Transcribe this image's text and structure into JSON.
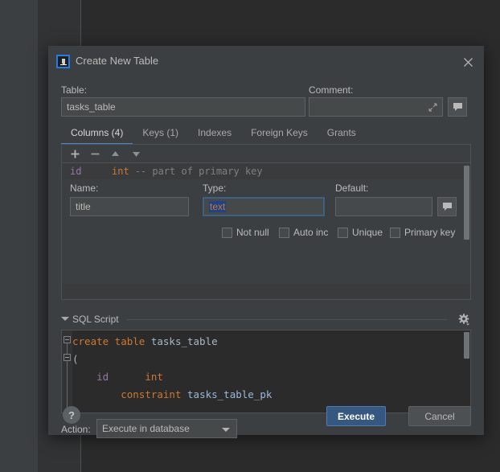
{
  "window": {
    "title": "Create New Table",
    "logo_text": "IJ",
    "close_icon": "close-icon"
  },
  "form": {
    "table_label": "Table:",
    "table_value": "tasks_table",
    "comment_label": "Comment:",
    "comment_value": "",
    "comment_placeholder": "",
    "expand_icon": "expand-icon",
    "comment_button_icon": "comment-bubble-icon"
  },
  "tabs": [
    {
      "label": "Columns (4)",
      "active": true
    },
    {
      "label": "Keys (1)",
      "active": false
    },
    {
      "label": "Indexes",
      "active": false
    },
    {
      "label": "Foreign Keys",
      "active": false
    },
    {
      "label": "Grants",
      "active": false
    }
  ],
  "columns_toolbar": [
    {
      "name": "add-column-button",
      "icon": "plus-icon",
      "label": "+"
    },
    {
      "name": "remove-column-button",
      "icon": "minus-icon",
      "label": "−"
    },
    {
      "name": "move-up-button",
      "icon": "arrow-up-icon",
      "label": "▲"
    },
    {
      "name": "move-down-button",
      "icon": "arrow-down-icon",
      "label": "▼"
    }
  ],
  "columns_rows": [
    {
      "name": "id",
      "type": "int",
      "comment": "-- part of primary key"
    }
  ],
  "column_editor": {
    "name_label": "Name:",
    "name_value": "title",
    "type_label": "Type:",
    "type_value": "text",
    "type_focused": true,
    "type_selected": true,
    "default_label": "Default:",
    "default_value": "",
    "default_comment_icon": "comment-bubble-icon",
    "checkboxes": [
      {
        "label": "Not null",
        "checked": false
      },
      {
        "label": "Auto inc",
        "checked": false
      },
      {
        "label": "Unique",
        "checked": false
      },
      {
        "label": "Primary key",
        "checked": false
      }
    ]
  },
  "sql_section": {
    "title": "SQL Script",
    "collapse_icon": "chevron-down-icon",
    "settings_icon": "gear-icon",
    "lines": [
      {
        "indent": 0,
        "fold": true,
        "tokens": [
          {
            "t": "create table ",
            "c": "sql-kw"
          },
          {
            "t": "tasks_table",
            "c": "sql-id"
          }
        ]
      },
      {
        "indent": 0,
        "fold": true,
        "tokens": [
          {
            "t": "(",
            "c": "sql-id"
          }
        ]
      },
      {
        "indent": 4,
        "fold": false,
        "tokens": [
          {
            "t": "id",
            "c": "sql-var"
          },
          {
            "t": "      ",
            "c": "sql-id"
          },
          {
            "t": "int",
            "c": "sql-kw"
          }
        ]
      },
      {
        "indent": 8,
        "fold": false,
        "tokens": [
          {
            "t": "constraint ",
            "c": "sql-kw"
          },
          {
            "t": "tasks_table_pk",
            "c": "sql-tbl"
          }
        ]
      }
    ]
  },
  "footer": {
    "action_label": "Action:",
    "action_value": "Execute in database",
    "help_label": "?",
    "execute_label": "Execute",
    "cancel_label": "Cancel"
  },
  "colors": {
    "accent": "#4a88c7",
    "primary_button": "#365880",
    "panel": "#3c3f41",
    "editor_bg": "#2b2b2b",
    "keyword": "#cc7832",
    "identifier": "#a9b7c6",
    "variable": "#9876aa",
    "table_name": "#9ab9dc",
    "comment": "#808080",
    "selection": "#214283"
  }
}
